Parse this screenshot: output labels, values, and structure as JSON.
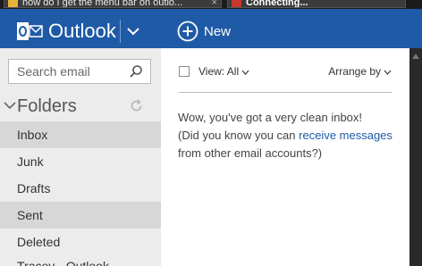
{
  "browser": {
    "tabs": [
      {
        "title": "how do I get the menu bar on outlo...",
        "close": "×"
      },
      {
        "title": "Connecting...",
        "close": "×"
      }
    ]
  },
  "header": {
    "brand": "Outlook",
    "new_label": "New",
    "color": "#1f5aa6"
  },
  "sidebar": {
    "search_placeholder": "Search email",
    "folders_title": "Folders",
    "folders": [
      {
        "label": "Inbox",
        "selected": true
      },
      {
        "label": "Junk"
      },
      {
        "label": "Drafts"
      },
      {
        "label": "Sent",
        "selected": true
      },
      {
        "label": "Deleted"
      },
      {
        "label": "Tracey - Outlook"
      }
    ]
  },
  "main": {
    "view_label": "View: All",
    "arrange_label": "Arrange by",
    "empty_line1": "Wow, you've got a very clean inbox!",
    "empty_pre": "(Did you know you can",
    "empty_link": "receive messages",
    "empty_post": "from other email accounts?)"
  }
}
